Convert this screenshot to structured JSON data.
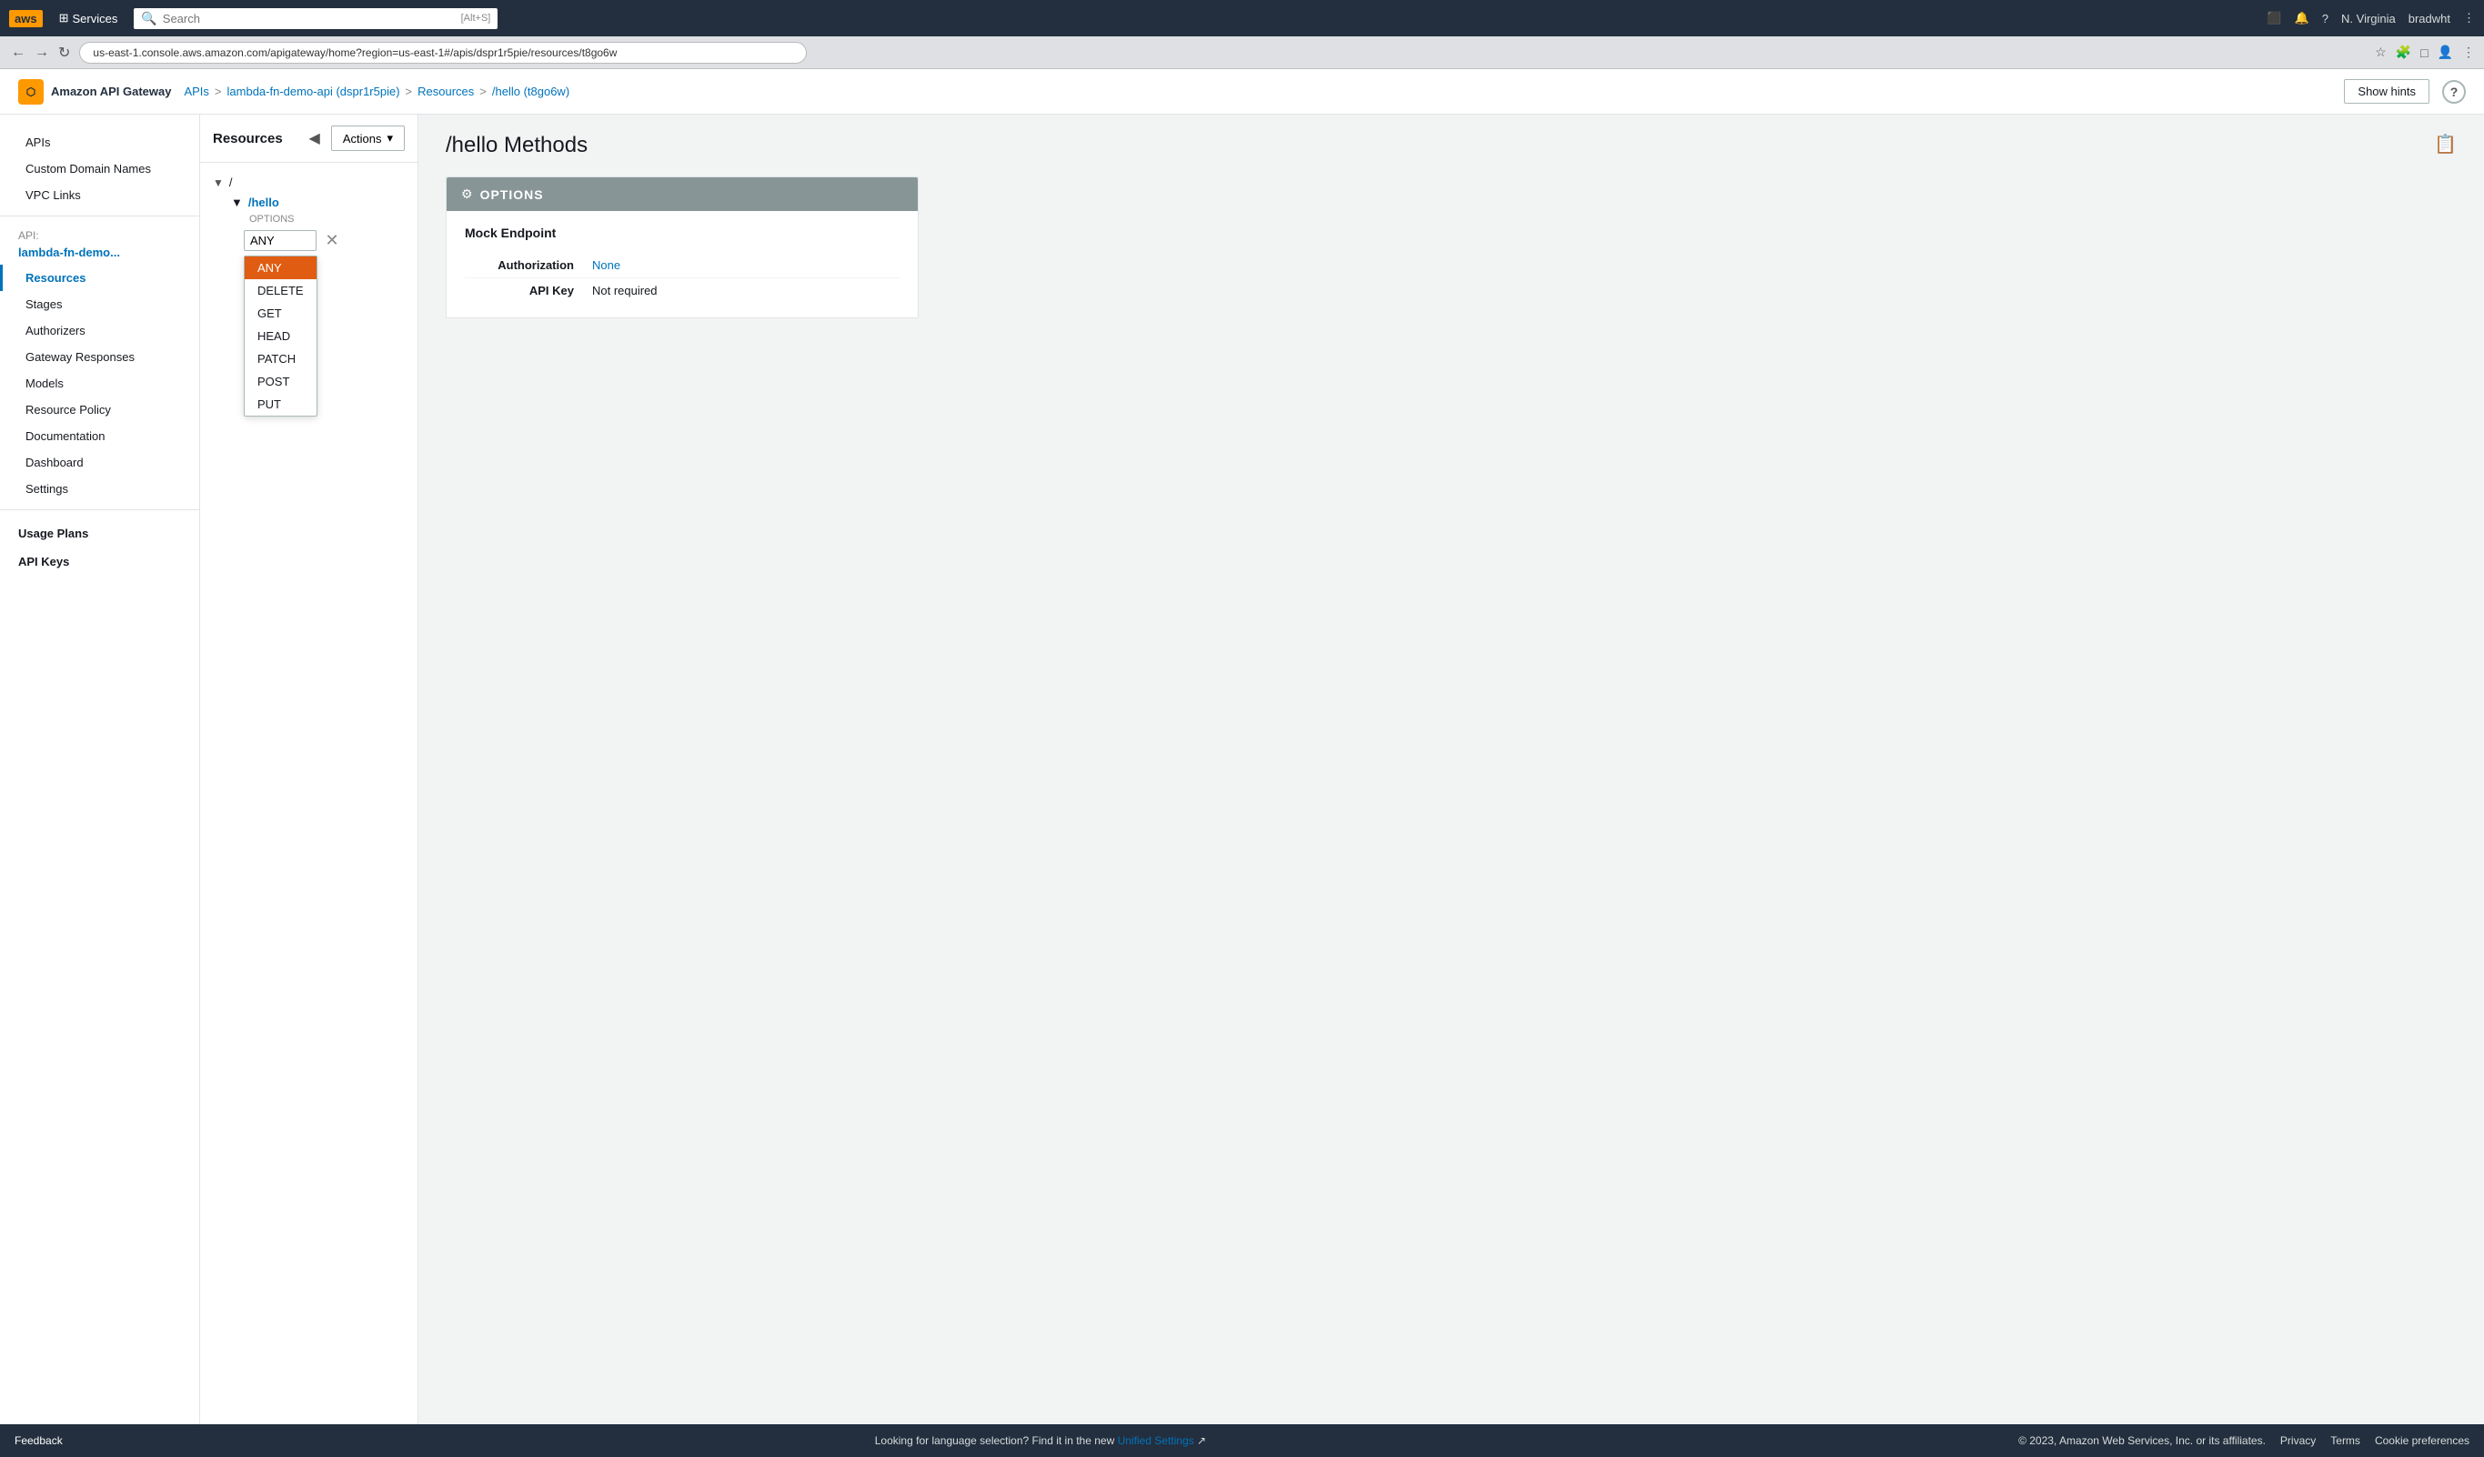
{
  "browser": {
    "url": "us-east-1.console.aws.amazon.com/apigateway/home?region=us-east-1#/apis/dspr1r5pie/resources/t8go6w",
    "back": "←",
    "forward": "→",
    "refresh": "↻"
  },
  "topnav": {
    "aws_label": "aws",
    "services_label": "Services",
    "search_placeholder": "Search",
    "search_shortcut": "[Alt+S]",
    "region_label": "N. Virginia",
    "user_label": "bradwht"
  },
  "secondary_nav": {
    "logo_icon": "⬡",
    "logo_text": "Amazon API Gateway",
    "breadcrumb": [
      {
        "label": "APIs",
        "link": true
      },
      {
        "label": "lambda-fn-demo-api (dspr1r5pie)",
        "link": true
      },
      {
        "label": "Resources",
        "link": true
      },
      {
        "label": "/hello (t8go6w)",
        "link": false
      }
    ],
    "show_hints": "Show hints"
  },
  "sidebar": {
    "top_items": [
      {
        "label": "APIs",
        "id": "apis"
      },
      {
        "label": "Custom Domain Names",
        "id": "custom-domain-names"
      },
      {
        "label": "VPC Links",
        "id": "vpc-links"
      }
    ],
    "api_label": "API:",
    "api_name": "lambda-fn-demo...",
    "nav_items": [
      {
        "label": "Resources",
        "id": "resources",
        "active": true
      },
      {
        "label": "Stages",
        "id": "stages"
      },
      {
        "label": "Authorizers",
        "id": "authorizers"
      },
      {
        "label": "Gateway Responses",
        "id": "gateway-responses"
      },
      {
        "label": "Models",
        "id": "models"
      },
      {
        "label": "Resource Policy",
        "id": "resource-policy"
      },
      {
        "label": "Documentation",
        "id": "documentation"
      },
      {
        "label": "Dashboard",
        "id": "dashboard"
      },
      {
        "label": "Settings",
        "id": "settings"
      }
    ],
    "bottom_groups": [
      {
        "label": "Usage Plans",
        "id": "usage-plans"
      },
      {
        "label": "API Keys",
        "id": "api-keys"
      }
    ]
  },
  "middle_panel": {
    "title": "Resources",
    "actions_label": "Actions",
    "tree": {
      "root_path": "/",
      "child_path": "/hello",
      "method_label": "OPTIONS"
    }
  },
  "dropdown": {
    "items": [
      "ANY",
      "DELETE",
      "GET",
      "HEAD",
      "PATCH",
      "POST",
      "PUT"
    ],
    "selected": "ANY"
  },
  "main": {
    "page_title": "/hello Methods",
    "options_header": "OPTIONS",
    "card_subtitle": "Mock Endpoint",
    "fields": [
      {
        "label": "Authorization",
        "value": "None",
        "value_class": "none"
      },
      {
        "label": "API Key",
        "value": "Not required",
        "value_class": ""
      }
    ]
  },
  "bottom_bar": {
    "feedback_label": "Feedback",
    "middle_text": "Looking for language selection? Find it in the new ",
    "unified_settings_label": "Unified Settings",
    "copyright": "© 2023, Amazon Web Services, Inc. or its affiliates.",
    "links": [
      "Privacy",
      "Terms",
      "Cookie preferences"
    ]
  }
}
